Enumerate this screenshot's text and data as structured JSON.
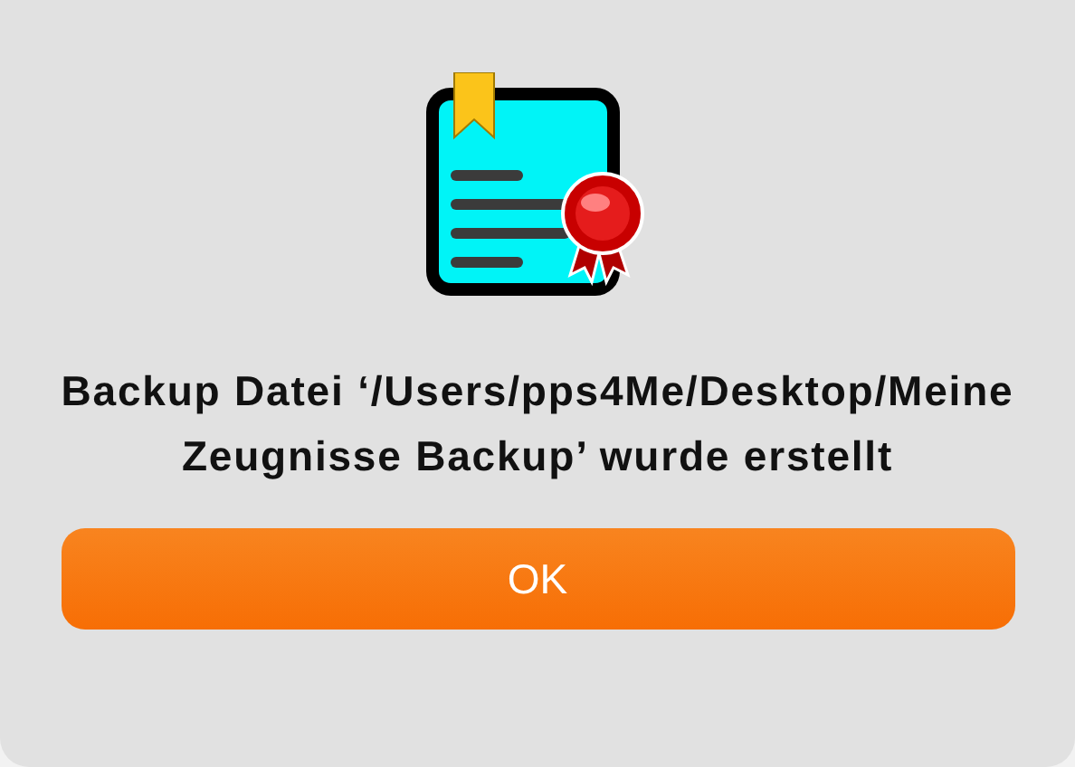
{
  "dialog": {
    "message": "Backup Datei ‘/Users/pps4Me/Desktop/Meine Zeugnisse Backup’ wurde erstellt",
    "buttons": [
      "OK"
    ]
  }
}
